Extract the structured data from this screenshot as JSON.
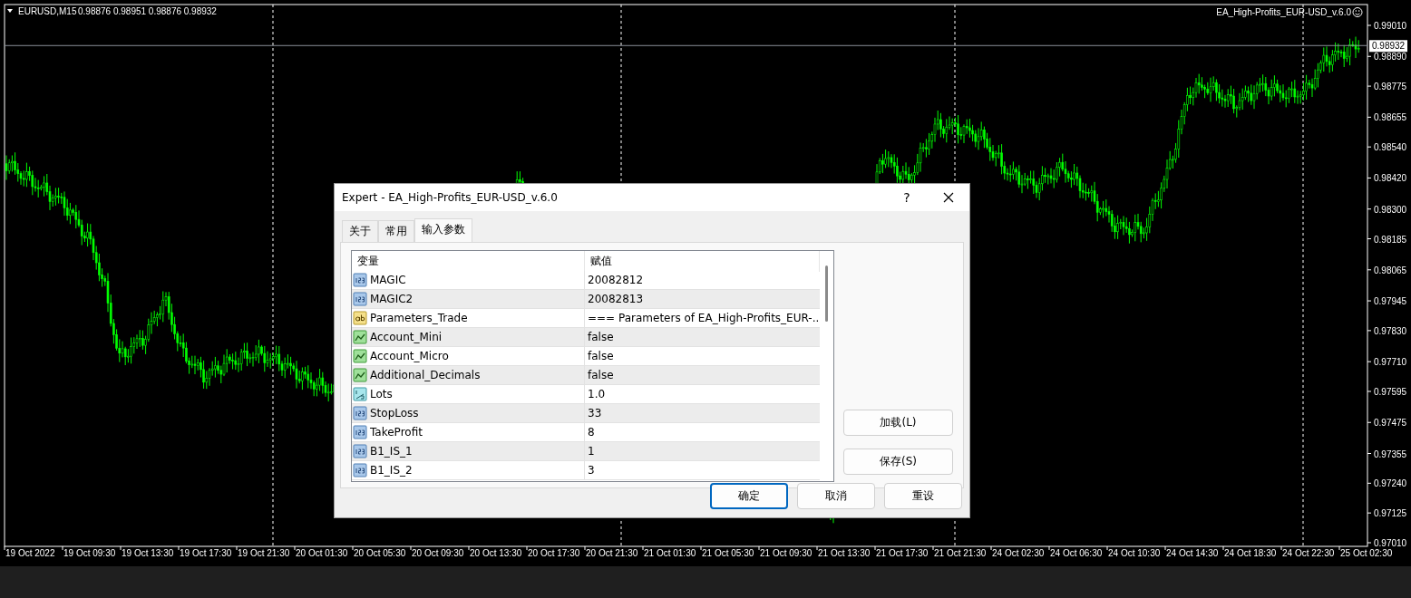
{
  "chart": {
    "symbol": "EURUSD,M15",
    "ohlc": "0.98876 0.98951 0.98876 0.98932",
    "expert_name": "EA_High-Profits_EUR-USD_v.6.0",
    "bid_label": "0.98932",
    "price_axis": [
      "0.99010",
      "0.98890",
      "0.98775",
      "0.98655",
      "0.98540",
      "0.98420",
      "0.98300",
      "0.98185",
      "0.98065",
      "0.97945",
      "0.97830",
      "0.97710",
      "0.97595",
      "0.97475",
      "0.97355",
      "0.97240",
      "0.97125",
      "0.97010"
    ],
    "time_axis": [
      "19 Oct 2022",
      "19 Oct 09:30",
      "19 Oct 13:30",
      "19 Oct 17:30",
      "19 Oct 21:30",
      "20 Oct 01:30",
      "20 Oct 05:30",
      "20 Oct 09:30",
      "20 Oct 13:30",
      "20 Oct 17:30",
      "20 Oct 21:30",
      "21 Oct 01:30",
      "21 Oct 05:30",
      "21 Oct 09:30",
      "21 Oct 13:30",
      "21 Oct 17:30",
      "21 Oct 21:30",
      "24 Oct 02:30",
      "24 Oct 06:30",
      "24 Oct 10:30",
      "24 Oct 14:30",
      "24 Oct 18:30",
      "24 Oct 22:30",
      "25 Oct 02:30"
    ]
  },
  "dialog": {
    "title": "Expert - EA_High-Profits_EUR-USD_v.6.0",
    "help": "?",
    "tabs": [
      {
        "label": "关于",
        "selected": false
      },
      {
        "label": "常用",
        "selected": false
      },
      {
        "label": "输入参数",
        "selected": true
      }
    ],
    "table": {
      "columns": [
        "变量",
        "赋值"
      ],
      "rows": [
        {
          "kind": "int",
          "name": "MAGIC",
          "value": "20082812"
        },
        {
          "kind": "int",
          "name": "MAGIC2",
          "value": "20082813"
        },
        {
          "kind": "string",
          "name": "Parameters_Trade",
          "value": "=== Parameters of EA_High-Profits_EUR-..."
        },
        {
          "kind": "bool",
          "name": "Account_Mini",
          "value": "false"
        },
        {
          "kind": "bool",
          "name": "Account_Micro",
          "value": "false"
        },
        {
          "kind": "bool",
          "name": "Additional_Decimals",
          "value": "false"
        },
        {
          "kind": "double",
          "name": "Lots",
          "value": "1.0"
        },
        {
          "kind": "int",
          "name": "StopLoss",
          "value": "33"
        },
        {
          "kind": "int",
          "name": "TakeProfit",
          "value": "8"
        },
        {
          "kind": "int",
          "name": "B1_IS_1",
          "value": "1"
        },
        {
          "kind": "int",
          "name": "B1_IS_2",
          "value": "3"
        }
      ]
    },
    "side_buttons": [
      "加载(L)",
      "保存(S)"
    ],
    "footer_buttons": [
      {
        "label": "确定",
        "default": true
      },
      {
        "label": "取消",
        "default": false
      },
      {
        "label": "重设",
        "default": false
      }
    ]
  }
}
